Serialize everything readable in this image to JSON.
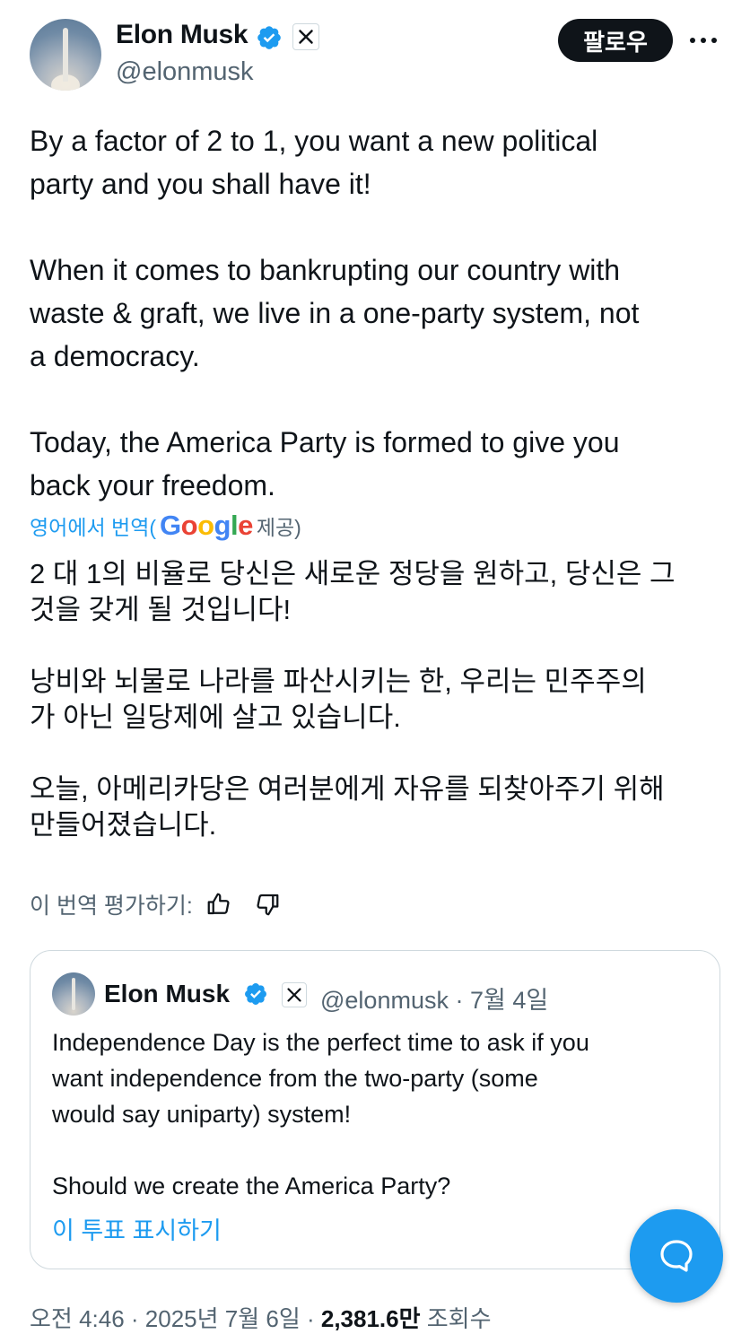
{
  "author": {
    "name": "Elon Musk",
    "handle": "@elonmusk"
  },
  "follow_label": "팔로우",
  "tweet_text": "By a factor of 2 to 1, you want a new political\nparty and you shall have it!\n\nWhen it comes to bankrupting our country with\nwaste & graft, we live in a one-party system, not\na democracy.\n\nToday, the America Party is formed to give you\nback your freedom.",
  "translation": {
    "link_label": "영어에서 번역(",
    "provider_logo": "Google",
    "provided_label": " 제공)",
    "text": "2 대 1의 비율로 당신은 새로운 정당을 원하고, 당신은 그\n것을 갖게 될 것입니다!\n\n낭비와 뇌물로 나라를 파산시키는 한, 우리는 민주주의\n가 아닌 일당제에 살고 있습니다.\n\n오늘, 아메리카당은 여러분에게 자유를 되찾아주기 위해\n만들어졌습니다.",
    "rate_label": "이 번역 평가하기:"
  },
  "quoted_tweet": {
    "name": "Elon Musk",
    "handle_date": "@elonmusk · 7월 4일",
    "text": "Independence Day is the perfect time to ask if you\nwant independence from the two-party (some\nwould say uniparty) system!\n\nShould we create the America Party?",
    "poll_link": "이 투표 표시하기"
  },
  "meta": {
    "time_date": "오전 4:46 · 2025년 7월 6일 · ",
    "views_count": "2,381.6만",
    "views_label": " 조회수"
  },
  "colors": {
    "accent": "#1d9bf0",
    "text": "#0f1419",
    "secondary": "#536471"
  },
  "icons": [
    "verified-badge-icon",
    "x-logo-icon",
    "more-icon",
    "thumbs-up-icon",
    "thumbs-down-icon",
    "compose-chat-icon"
  ]
}
